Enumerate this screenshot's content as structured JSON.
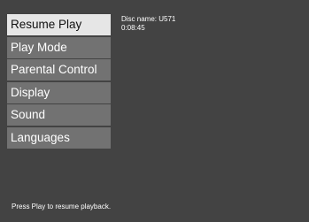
{
  "menu": {
    "items": [
      {
        "label": "Resume Play",
        "selected": true
      },
      {
        "label": "Play Mode",
        "selected": false
      },
      {
        "label": "Parental Control",
        "selected": false
      },
      {
        "label": "Display",
        "selected": false
      },
      {
        "label": "Sound",
        "selected": false
      },
      {
        "label": "Languages",
        "selected": false
      }
    ]
  },
  "info": {
    "disc_name": "Disc name: U571",
    "time": "0:08:45"
  },
  "status": {
    "message": "Press Play to resume playback."
  },
  "colors": {
    "background": "#434343",
    "menu_item": "#727272",
    "menu_item_selected": "#e6e6e6",
    "text": "#ffffff",
    "text_selected": "#111111"
  }
}
